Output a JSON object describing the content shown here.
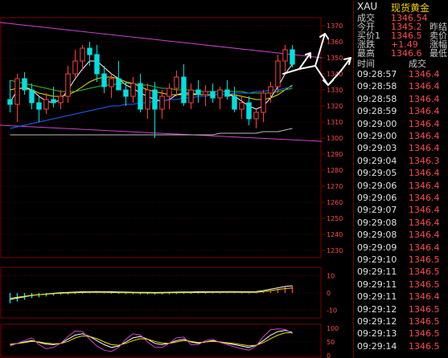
{
  "colors": {
    "background": "#000000",
    "grid": "#7a0000",
    "candle_up": "#ff4040",
    "candle_down": "#00e0e0",
    "price_red": "#ff4a4a",
    "symbol_yellow": "#f0d000",
    "channel": "#cc44cc",
    "ma_white": "#ffffff",
    "ma_yellow": "#e8e000",
    "ma_green": "#30c030",
    "ma_blue": "#2060ff",
    "ma_gray": "#bbbbbb"
  },
  "quote": {
    "symbol": "XAU",
    "name": "现货黄金",
    "rows": [
      {
        "label": "成交",
        "value": "1346.54",
        "color": "red",
        "extra": ""
      },
      {
        "label": "今开",
        "value": "1345.2",
        "color": "red",
        "extra": "昨结"
      },
      {
        "label": "买价1",
        "value": "1346.5",
        "color": "red",
        "extra": "卖价"
      },
      {
        "label": "涨跌",
        "value": "+1.49",
        "color": "red",
        "extra": "涨幅"
      },
      {
        "label": "最高",
        "value": "1346.6",
        "color": "red",
        "extra": "最低"
      }
    ]
  },
  "ticks": {
    "header_time": "时间",
    "header_price": "成交",
    "rows": [
      {
        "time": "09:28:57",
        "price": "1346.4"
      },
      {
        "time": "09:28:58",
        "price": "1346.4"
      },
      {
        "time": "09:28:58",
        "price": "1346.4"
      },
      {
        "time": "09:28:59",
        "price": "1346.4"
      },
      {
        "time": "09:29:00",
        "price": "1346.4"
      },
      {
        "time": "09:29:00",
        "price": "1346.4"
      },
      {
        "time": "09:29:03",
        "price": "1346.4"
      },
      {
        "time": "09:29:04",
        "price": "1346.3"
      },
      {
        "time": "09:29:05",
        "price": "1346.4"
      },
      {
        "time": "09:29:06",
        "price": "1346.4"
      },
      {
        "time": "09:29:06",
        "price": "1346.4"
      },
      {
        "time": "09:29:07",
        "price": "1346.4"
      },
      {
        "time": "09:29:08",
        "price": "1346.4"
      },
      {
        "time": "09:29:08",
        "price": "1346.4"
      },
      {
        "time": "09:29:09",
        "price": "1346.4"
      },
      {
        "time": "09:29:10",
        "price": "1346.5"
      },
      {
        "time": "09:29:11",
        "price": "1346.5"
      },
      {
        "time": "09:29:11",
        "price": "1346.5"
      },
      {
        "time": "09:29:11",
        "price": "1346.4"
      },
      {
        "time": "09:29:12",
        "price": "1346.5"
      },
      {
        "time": "09:29:12",
        "price": "1346.5"
      },
      {
        "time": "09:29:13",
        "price": "1346.5"
      },
      {
        "time": "09:29:14",
        "price": "1346.5"
      }
    ]
  },
  "chart_data": [
    {
      "type": "candlestick",
      "y_ticks": [
        "1370",
        "1360",
        "1350",
        "1340",
        "1330",
        "1320",
        "1310",
        "1300",
        "1290",
        "1280",
        "1270",
        "1260",
        "1250",
        "1240",
        "1230"
      ],
      "ylim": [
        1225,
        1375
      ],
      "candles": [
        {
          "o": 1324,
          "h": 1336,
          "l": 1316,
          "c": 1321
        },
        {
          "o": 1321,
          "h": 1340,
          "l": 1310,
          "c": 1337
        },
        {
          "o": 1337,
          "h": 1341,
          "l": 1327,
          "c": 1330
        },
        {
          "o": 1330,
          "h": 1334,
          "l": 1318,
          "c": 1322
        },
        {
          "o": 1322,
          "h": 1326,
          "l": 1310,
          "c": 1318
        },
        {
          "o": 1318,
          "h": 1328,
          "l": 1315,
          "c": 1324
        },
        {
          "o": 1324,
          "h": 1332,
          "l": 1319,
          "c": 1322
        },
        {
          "o": 1322,
          "h": 1330,
          "l": 1318,
          "c": 1326
        },
        {
          "o": 1326,
          "h": 1345,
          "l": 1322,
          "c": 1340
        },
        {
          "o": 1340,
          "h": 1355,
          "l": 1338,
          "c": 1348
        },
        {
          "o": 1348,
          "h": 1358,
          "l": 1342,
          "c": 1356
        },
        {
          "o": 1356,
          "h": 1360,
          "l": 1345,
          "c": 1352
        },
        {
          "o": 1352,
          "h": 1358,
          "l": 1335,
          "c": 1340
        },
        {
          "o": 1340,
          "h": 1345,
          "l": 1328,
          "c": 1332
        },
        {
          "o": 1332,
          "h": 1340,
          "l": 1325,
          "c": 1337
        },
        {
          "o": 1337,
          "h": 1348,
          "l": 1330,
          "c": 1330
        },
        {
          "o": 1330,
          "h": 1335,
          "l": 1320,
          "c": 1326
        },
        {
          "o": 1326,
          "h": 1338,
          "l": 1322,
          "c": 1334
        },
        {
          "o": 1334,
          "h": 1340,
          "l": 1316,
          "c": 1318
        },
        {
          "o": 1318,
          "h": 1334,
          "l": 1312,
          "c": 1330
        },
        {
          "o": 1330,
          "h": 1335,
          "l": 1300,
          "c": 1318
        },
        {
          "o": 1318,
          "h": 1330,
          "l": 1312,
          "c": 1326
        },
        {
          "o": 1326,
          "h": 1334,
          "l": 1318,
          "c": 1331
        },
        {
          "o": 1331,
          "h": 1342,
          "l": 1326,
          "c": 1338
        },
        {
          "o": 1338,
          "h": 1346,
          "l": 1320,
          "c": 1322
        },
        {
          "o": 1322,
          "h": 1334,
          "l": 1318,
          "c": 1330
        },
        {
          "o": 1330,
          "h": 1336,
          "l": 1322,
          "c": 1327
        },
        {
          "o": 1327,
          "h": 1333,
          "l": 1320,
          "c": 1329
        },
        {
          "o": 1329,
          "h": 1334,
          "l": 1322,
          "c": 1325
        },
        {
          "o": 1325,
          "h": 1332,
          "l": 1318,
          "c": 1330
        },
        {
          "o": 1330,
          "h": 1336,
          "l": 1324,
          "c": 1326
        },
        {
          "o": 1326,
          "h": 1332,
          "l": 1316,
          "c": 1318
        },
        {
          "o": 1318,
          "h": 1326,
          "l": 1312,
          "c": 1322
        },
        {
          "o": 1322,
          "h": 1326,
          "l": 1308,
          "c": 1312
        },
        {
          "o": 1312,
          "h": 1318,
          "l": 1306,
          "c": 1316
        },
        {
          "o": 1316,
          "h": 1330,
          "l": 1310,
          "c": 1328
        },
        {
          "o": 1328,
          "h": 1335,
          "l": 1322,
          "c": 1332
        },
        {
          "o": 1332,
          "h": 1352,
          "l": 1328,
          "c": 1348
        },
        {
          "o": 1348,
          "h": 1358,
          "l": 1340,
          "c": 1355
        },
        {
          "o": 1355,
          "h": 1358,
          "l": 1344,
          "c": 1346
        }
      ],
      "ma_series": [
        {
          "color": "ma_white",
          "values": [
            1322,
            1330,
            1332,
            1330,
            1326,
            1323,
            1322,
            1324,
            1330,
            1337,
            1343,
            1348,
            1348,
            1344,
            1340,
            1337,
            1333,
            1331,
            1328,
            1326,
            1324,
            1323,
            1324,
            1327,
            1328,
            1328,
            1327,
            1327,
            1327,
            1327,
            1327,
            1326,
            1323,
            1320,
            1318,
            1320,
            1325,
            1332,
            1340,
            1346
          ]
        },
        {
          "color": "ma_yellow",
          "values": [
            1330,
            1331,
            1331,
            1330,
            1328,
            1327,
            1326,
            1326,
            1327,
            1329,
            1332,
            1335,
            1337,
            1338,
            1338,
            1337,
            1335,
            1334,
            1332,
            1330,
            1329,
            1328,
            1327,
            1327,
            1327,
            1327,
            1327,
            1327,
            1327,
            1327,
            1327,
            1327,
            1326,
            1325,
            1324,
            1324,
            1325,
            1327,
            1330,
            1333
          ]
        },
        {
          "color": "ma_green",
          "values": [
            1336,
            1335,
            1334,
            1333,
            1332,
            1331,
            1330,
            1329,
            1329,
            1329,
            1330,
            1331,
            1332,
            1333,
            1333,
            1334,
            1334,
            1334,
            1333,
            1333,
            1332,
            1331,
            1331,
            1330,
            1330,
            1330,
            1329,
            1329,
            1329,
            1329,
            1329,
            1329,
            1329,
            1328,
            1328,
            1328,
            1328,
            1329,
            1330,
            1331
          ]
        },
        {
          "color": "ma_blue",
          "values": [
            1306,
            1307,
            1308,
            1309,
            1310,
            1311,
            1312,
            1313,
            1314,
            1315,
            1316,
            1317,
            1318,
            1319,
            1320,
            1320,
            1321,
            1321,
            1322,
            1322,
            1323,
            1323,
            1324,
            1324,
            1325,
            1325,
            1326,
            1326,
            1327,
            1327,
            1327,
            1328,
            1328,
            1328,
            1329,
            1329,
            1330,
            1330,
            1331,
            1332
          ]
        },
        {
          "color": "ma_gray",
          "values": [
            1302,
            1302,
            1302,
            1302,
            1302,
            1302,
            1302,
            1302,
            1302,
            1302,
            1302,
            1302,
            1302,
            1302,
            1302,
            1302,
            1302,
            1302,
            1302,
            1302,
            1302,
            1302,
            1302,
            1302,
            1302,
            1302,
            1302,
            1302,
            1302,
            1303,
            1303,
            1303,
            1303,
            1303,
            1303,
            1304,
            1304,
            1304,
            1305,
            1306
          ]
        }
      ]
    },
    {
      "type": "bar",
      "y_ticks": [
        "10",
        "0",
        "-10"
      ],
      "ylim": [
        -15,
        15
      ],
      "values": [
        -6,
        -5,
        -4,
        -3,
        -2.5,
        -2,
        -1.5,
        -1,
        -0.8,
        -0.6,
        -0.4,
        -0.3,
        -0.2,
        -0.3,
        -0.4,
        -0.5,
        -0.6,
        -0.7,
        -0.8,
        -0.8,
        -0.9,
        -0.8,
        -0.7,
        -0.6,
        -0.5,
        -0.5,
        -0.4,
        -0.4,
        -0.3,
        -0.3,
        -0.2,
        -0.2,
        -0.3,
        -0.3,
        -0.2,
        0.5,
        1.5,
        2.5,
        3.5,
        4
      ]
    },
    {
      "type": "line",
      "y_ticks": [
        "100",
        "50",
        "0"
      ],
      "ylim": [
        0,
        100
      ],
      "series": [
        {
          "color": "ma_white",
          "values": [
            40,
            45,
            50,
            55,
            48,
            42,
            40,
            45,
            60,
            75,
            80,
            70,
            55,
            40,
            30,
            35,
            50,
            65,
            70,
            60,
            45,
            40,
            45,
            55,
            60,
            50,
            45,
            50,
            55,
            50,
            45,
            40,
            35,
            30,
            38,
            55,
            75,
            88,
            92,
            85
          ]
        },
        {
          "color": "ma_yellow",
          "values": [
            42,
            44,
            48,
            52,
            50,
            46,
            43,
            44,
            52,
            65,
            72,
            70,
            62,
            50,
            40,
            38,
            45,
            55,
            62,
            60,
            52,
            46,
            45,
            50,
            55,
            52,
            48,
            50,
            52,
            50,
            47,
            44,
            40,
            36,
            38,
            48,
            62,
            75,
            83,
            84
          ]
        },
        {
          "color": "channel",
          "values": [
            35,
            45,
            55,
            65,
            40,
            25,
            30,
            45,
            70,
            90,
            88,
            60,
            35,
            20,
            15,
            30,
            60,
            80,
            75,
            50,
            30,
            30,
            45,
            65,
            68,
            40,
            40,
            55,
            60,
            48,
            40,
            32,
            25,
            20,
            35,
            70,
            95,
            98,
            96,
            80
          ]
        }
      ]
    }
  ]
}
